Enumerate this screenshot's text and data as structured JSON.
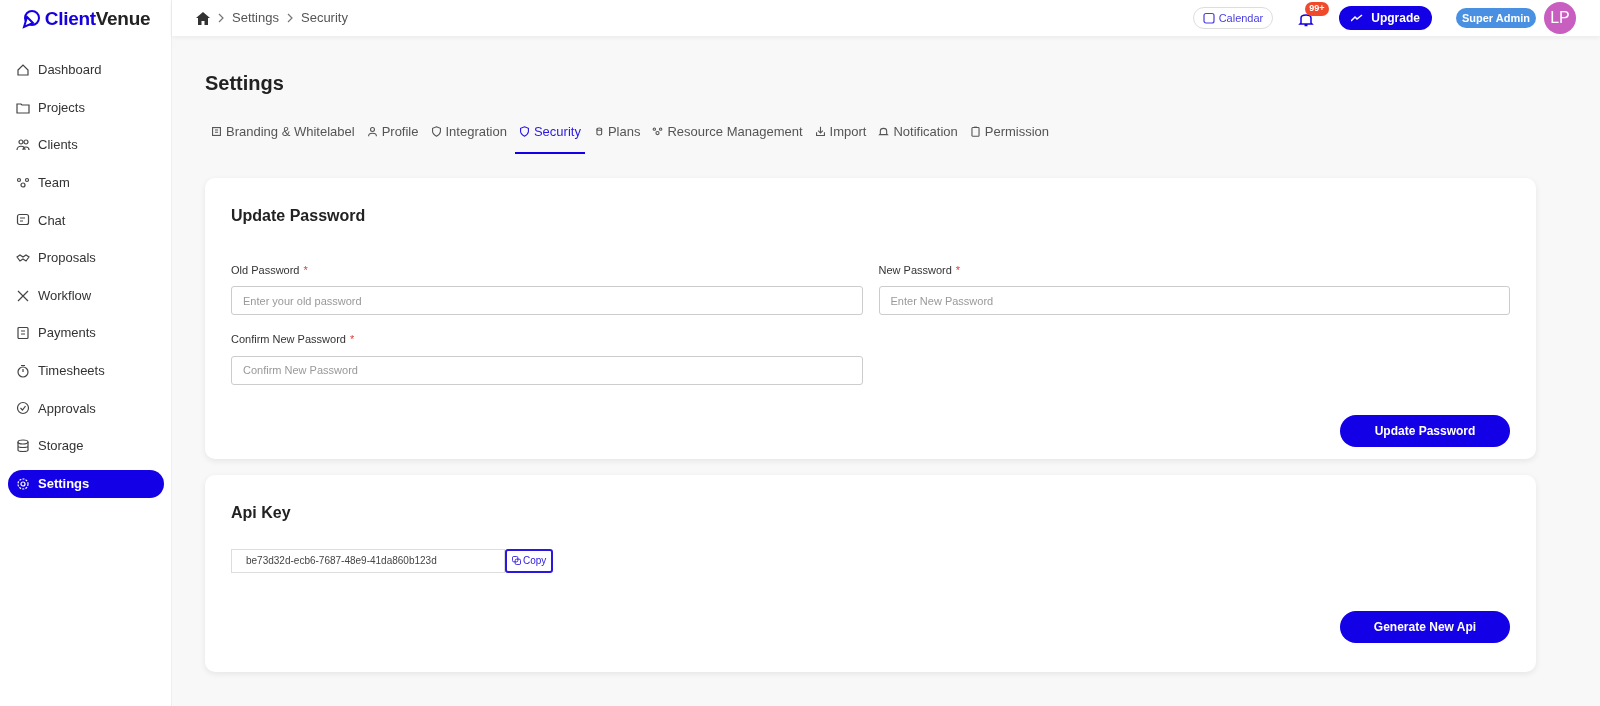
{
  "brand": {
    "name_part1": "Client",
    "name_part2": "Venue"
  },
  "sidebar": {
    "items": [
      {
        "label": "Dashboard",
        "selected": false
      },
      {
        "label": "Projects",
        "selected": false
      },
      {
        "label": "Clients",
        "selected": false
      },
      {
        "label": "Team",
        "selected": false
      },
      {
        "label": "Chat",
        "selected": false
      },
      {
        "label": "Proposals",
        "selected": false
      },
      {
        "label": "Workflow",
        "selected": false
      },
      {
        "label": "Payments",
        "selected": false
      },
      {
        "label": "Timesheets",
        "selected": false
      },
      {
        "label": "Approvals",
        "selected": false
      },
      {
        "label": "Storage",
        "selected": false
      },
      {
        "label": "Settings",
        "selected": true
      }
    ]
  },
  "breadcrumb": [
    "Settings",
    "Security"
  ],
  "header": {
    "calendar": "Calendar",
    "notifications": "99+",
    "upgrade": "Upgrade",
    "role": "Super Admin",
    "avatar": "LP"
  },
  "page_title": "Settings",
  "tabs": [
    {
      "label": "Branding & Whitelabel",
      "selected": false
    },
    {
      "label": "Profile",
      "selected": false
    },
    {
      "label": "Integration",
      "selected": false
    },
    {
      "label": "Security",
      "selected": true
    },
    {
      "label": "Plans",
      "selected": false
    },
    {
      "label": "Resource Management",
      "selected": false
    },
    {
      "label": "Import",
      "selected": false
    },
    {
      "label": "Notification",
      "selected": false
    },
    {
      "label": "Permission",
      "selected": false
    }
  ],
  "password_card": {
    "title": "Update Password",
    "fields": [
      {
        "label": "Old Password",
        "required_mark": "*",
        "placeholder": "Enter your old password"
      },
      {
        "label": "New Password",
        "required_mark": "*",
        "placeholder": "Enter New Password"
      },
      {
        "label": "Confirm New Password",
        "required_mark": "*",
        "placeholder": "Confirm New Password"
      }
    ],
    "button": "Update Password"
  },
  "api_card": {
    "title": "Api Key",
    "value": "be73d32d-ecb6-7687-48e9-41da860b123d",
    "copy": "Copy",
    "button": "Generate New Api"
  }
}
